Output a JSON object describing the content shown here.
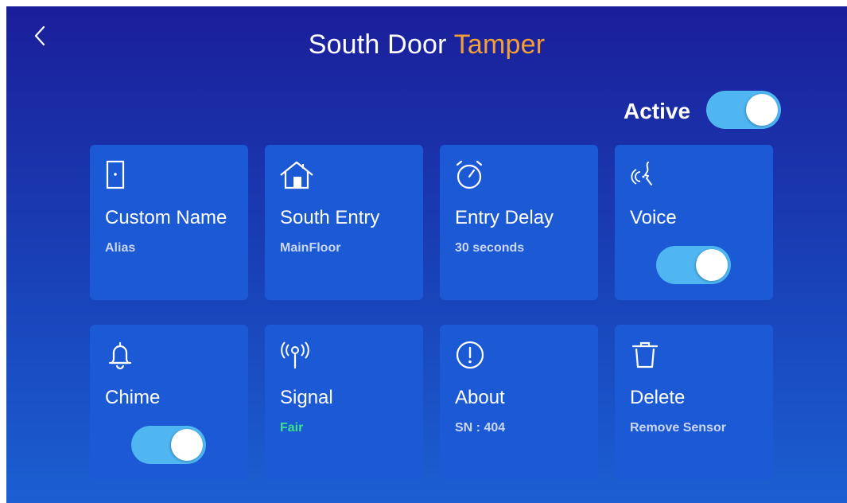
{
  "header": {
    "title_main": "South Door ",
    "title_accent": "Tamper",
    "accent_color": "#f5a033"
  },
  "active": {
    "label": "Active",
    "on": true
  },
  "cards": [
    {
      "icon": "door-icon",
      "label": "Custom Name",
      "sub": "Alias"
    },
    {
      "icon": "house-icon",
      "label": "South Entry",
      "sub": "MainFloor"
    },
    {
      "icon": "stopwatch-icon",
      "label": "Entry Delay",
      "sub": "30  seconds"
    },
    {
      "icon": "voice-icon",
      "label": "Voice",
      "toggle_on": true
    },
    {
      "icon": "bell-icon",
      "label": "Chime",
      "toggle_on": true
    },
    {
      "icon": "antenna-signal-icon",
      "label": "Signal",
      "sub": "Fair",
      "sub_color": "#3de08a"
    },
    {
      "icon": "info-exclamation-icon",
      "label": "About",
      "sub": "SN : 404"
    },
    {
      "icon": "trash-icon",
      "label": "Delete",
      "sub": "Remove Sensor"
    }
  ],
  "colors": {
    "background_top": "#1b1e9a",
    "background_bottom": "#1b5fd2",
    "card": "#1c59d4",
    "toggle_on": "#4fb6f2"
  }
}
